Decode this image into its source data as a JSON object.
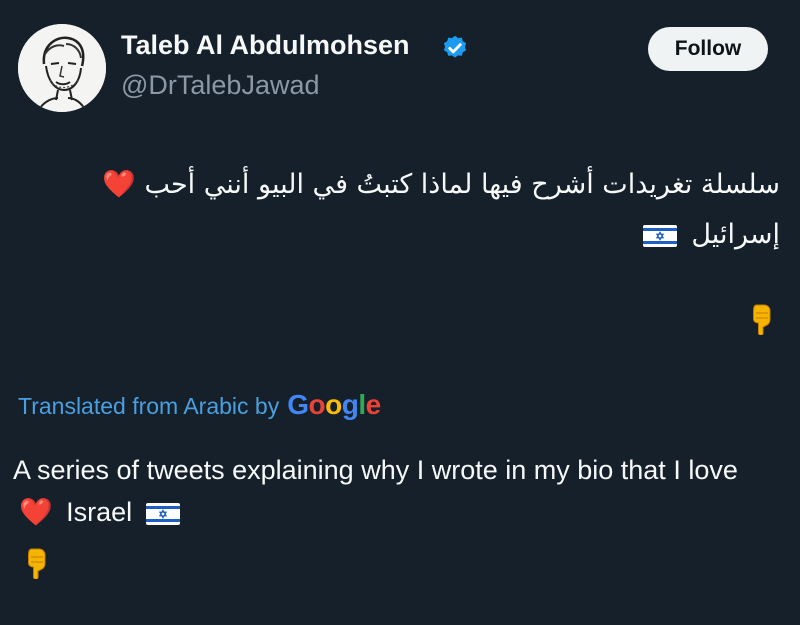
{
  "user": {
    "display_name": "Taleb Al Abdulmohsen",
    "handle": "@DrTalebJawad",
    "verified": true,
    "avatar": "sketch-portrait"
  },
  "follow": {
    "label": "Follow"
  },
  "tweet": {
    "original_text": "سلسلة تغريدات أشرح فيها لماذا كتبتُ في البيو أنني أحب",
    "original_word_2": "إسرائيل",
    "heart_emoji": "❤️",
    "flag_icon": "israel-flag",
    "pointing_emoji": "👇"
  },
  "translation": {
    "prefix": "Translated from Arabic by",
    "provider": "Google",
    "provider_colors": [
      "#4285f4",
      "#ea4335",
      "#fbbc05",
      "#4285f4",
      "#34a853",
      "#ea4335"
    ],
    "text_part1": "A series of tweets explaining why I wrote in my bio that I love",
    "text_part2": "Israel"
  },
  "colors": {
    "background": "#15202b",
    "verified_badge": "#1d9bf0",
    "link": "#4a9fe0"
  }
}
